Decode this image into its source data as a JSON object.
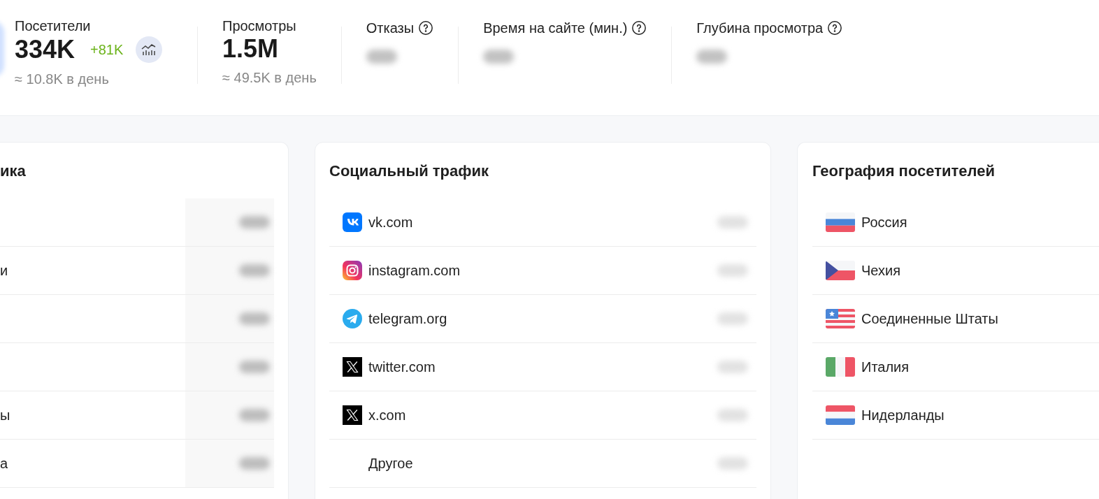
{
  "metrics": [
    {
      "label": "Посетители",
      "value": "334K",
      "delta": "+81K",
      "per_day": "≈ 10.8K в день",
      "chart_button": true,
      "blurred": false
    },
    {
      "label": "Просмотры",
      "value": "1.5M",
      "per_day": "≈ 49.5K в день",
      "blurred": false
    },
    {
      "label": "Отказы",
      "help": true,
      "blurred": true
    },
    {
      "label": "Время на сайте (мин.)",
      "help": true,
      "blurred": true
    },
    {
      "label": "Глубина просмотра",
      "help": true,
      "blurred": true
    }
  ],
  "sources_card": {
    "title": "ика",
    "rows": [
      {
        "blurred": true
      },
      {
        "label": "и",
        "blurred": true
      },
      {
        "blurred": true
      },
      {
        "blurred": true
      },
      {
        "label": "ы",
        "blurred": true
      },
      {
        "label": "а",
        "blurred": true
      }
    ]
  },
  "social_card": {
    "title": "Социальный трафик",
    "rows": [
      {
        "kind": "vk",
        "label": "vk.com",
        "blurred": true
      },
      {
        "kind": "instagram",
        "label": "instagram.com",
        "blurred": true
      },
      {
        "kind": "telegram",
        "label": "telegram.org",
        "blurred": true
      },
      {
        "kind": "x",
        "label": "twitter.com",
        "blurred": true
      },
      {
        "kind": "x",
        "label": "x.com",
        "blurred": true
      },
      {
        "kind": "none",
        "label": "Другое",
        "blurred": true
      }
    ]
  },
  "geo_card": {
    "title": "География посетителей",
    "rows": [
      {
        "kind": "ru",
        "label": "Россия"
      },
      {
        "kind": "cz",
        "label": "Чехия"
      },
      {
        "kind": "us",
        "label": "Соединенные Штаты"
      },
      {
        "kind": "it",
        "label": "Италия"
      },
      {
        "kind": "nl",
        "label": "Нидерланды"
      }
    ]
  }
}
